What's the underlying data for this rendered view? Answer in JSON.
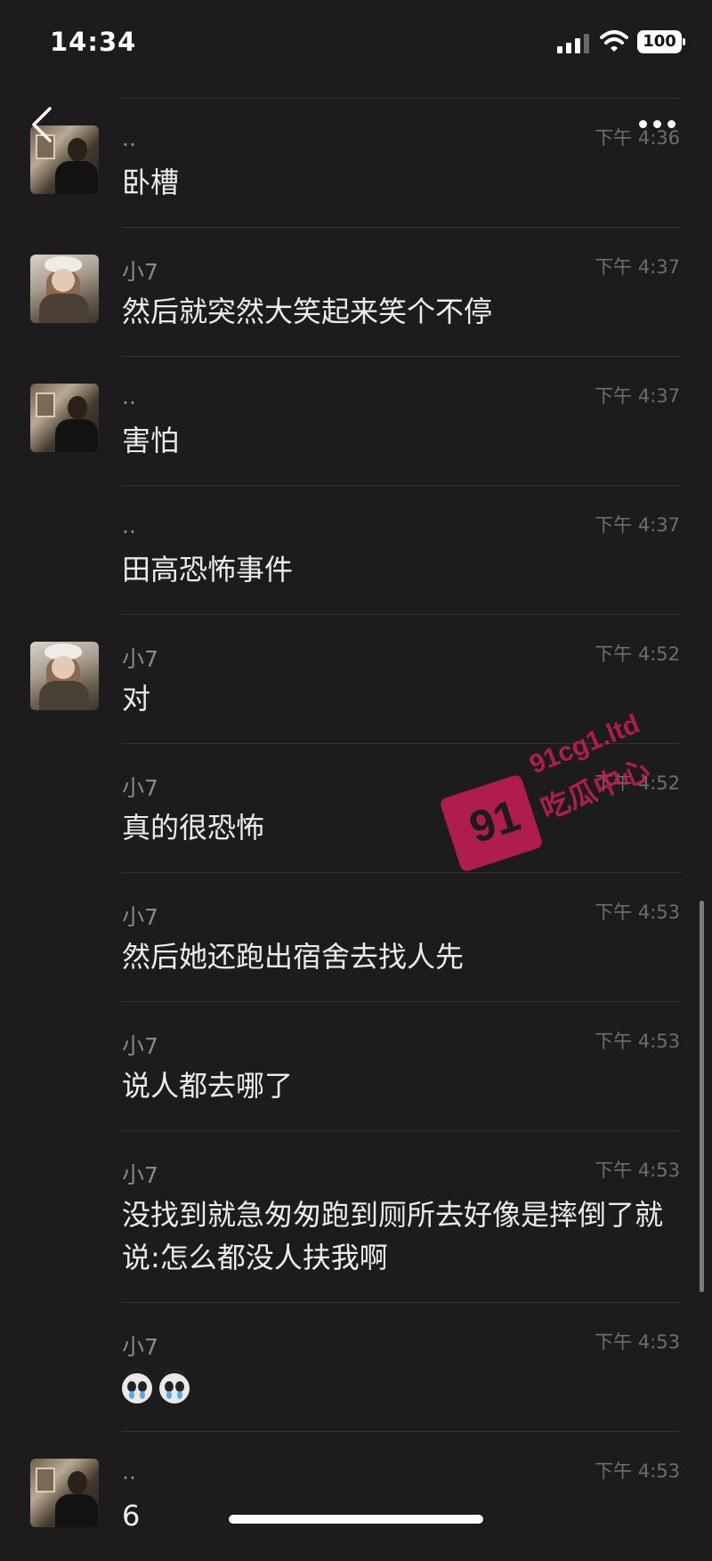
{
  "status_bar": {
    "time": "14:34",
    "battery": "100",
    "icons": [
      "signal-icon",
      "wifi-icon",
      "battery-icon"
    ]
  },
  "header": {
    "back_icon": "chevron-left-icon",
    "more_icon": "more-dots-icon"
  },
  "messages": [
    {
      "sender": "..",
      "avatar": "boy",
      "show_avatar": true,
      "time": "下午 4:36",
      "text": "卧槽",
      "lines": 1
    },
    {
      "sender": "小7",
      "avatar": "girl",
      "show_avatar": true,
      "time": "下午 4:37",
      "text": "然后就突然大笑起来笑个不停",
      "lines": 1
    },
    {
      "sender": "..",
      "avatar": "boy",
      "show_avatar": true,
      "time": "下午 4:37",
      "text": "害怕",
      "lines": 1
    },
    {
      "sender": "..",
      "avatar": "boy",
      "show_avatar": false,
      "time": "下午 4:37",
      "text": "田高恐怖事件",
      "lines": 1
    },
    {
      "sender": "小7",
      "avatar": "girl",
      "show_avatar": true,
      "time": "下午 4:52",
      "text": "对",
      "lines": 1
    },
    {
      "sender": "小7",
      "avatar": "girl",
      "show_avatar": false,
      "time": "下午 4:52",
      "text": "真的很恐怖",
      "lines": 1
    },
    {
      "sender": "小7",
      "avatar": "girl",
      "show_avatar": false,
      "time": "下午 4:53",
      "text": "然后她还跑出宿舍去找人先",
      "lines": 1
    },
    {
      "sender": "小7",
      "avatar": "girl",
      "show_avatar": false,
      "time": "下午 4:53",
      "text": "说人都去哪了",
      "lines": 1
    },
    {
      "sender": "小7",
      "avatar": "girl",
      "show_avatar": false,
      "time": "下午 4:53",
      "text": "没找到就急匆匆跑到厕所去好像是摔倒了就说:怎么都没人扶我啊",
      "lines": 2
    },
    {
      "sender": "小7",
      "avatar": "girl",
      "show_avatar": false,
      "time": "下午 4:53",
      "text": "",
      "emoji_count": 2,
      "emoji_icon": "crying-face-icon",
      "lines": 1
    },
    {
      "sender": "..",
      "avatar": "boy",
      "show_avatar": true,
      "time": "下午 4:53",
      "text": "6",
      "lines": 1,
      "last": true
    }
  ],
  "watermark": {
    "number": "91",
    "domain": "91cg1.ltd",
    "label": "吃瓜中心"
  }
}
